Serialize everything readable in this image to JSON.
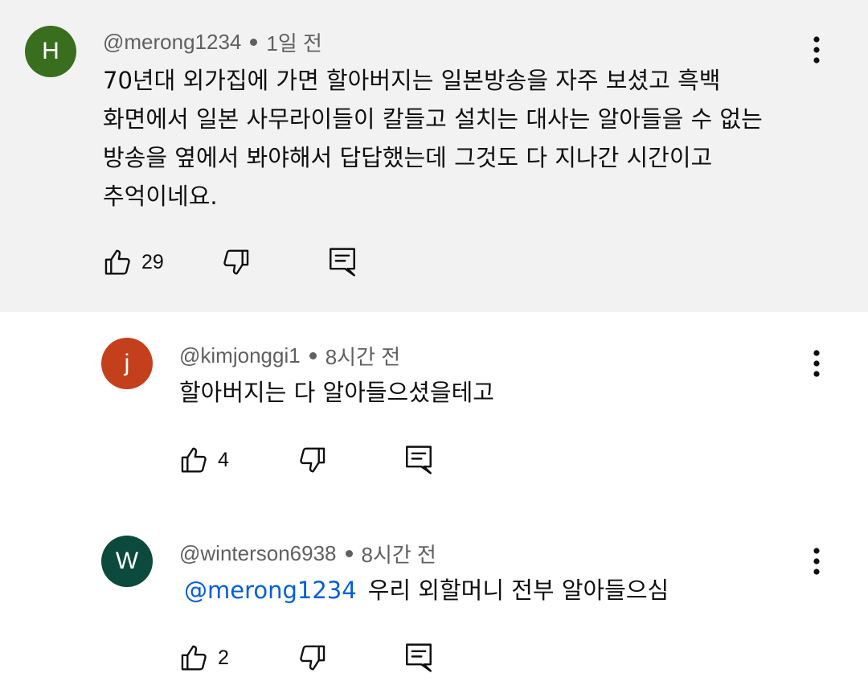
{
  "comments": [
    {
      "avatar_letter": "H",
      "avatar_color": "#3a6e1f",
      "author": "@merong1234",
      "time": "1일 전",
      "lines": [
        "70년대 외가집에 가면 할아버지는 일본방송을 자주 보셨고 흑백",
        "화면에서 일본 사무라이들이 칼들고 설치는 대사는 알아들을 수 없는",
        "방송을 옆에서 봐야해서 답답했는데 그것도 다 지나간 시간이고",
        "추억이네요."
      ],
      "likes": "29",
      "highlighted": true
    },
    {
      "avatar_letter": "j",
      "avatar_color": "#c4401c",
      "author": "@kimjonggi1",
      "time": "8시간 전",
      "text": "할아버지는 다 알아들으셨을테고",
      "likes": "4"
    },
    {
      "avatar_letter": "W",
      "avatar_color": "#0b4a3c",
      "author": "@winterson6938",
      "time": "8시간 전",
      "mention": "@merong1234",
      "text": "우리 외할머니 전부 알아들으심",
      "likes": "2"
    }
  ],
  "icons": {
    "like": "thumbs-up-icon",
    "dislike": "thumbs-down-icon",
    "reply": "reply-icon",
    "more": "more-vert-icon"
  },
  "colors": {
    "highlight_bg": "#f2f2f2",
    "mention": "#065fd4",
    "meta_text": "#606060"
  }
}
